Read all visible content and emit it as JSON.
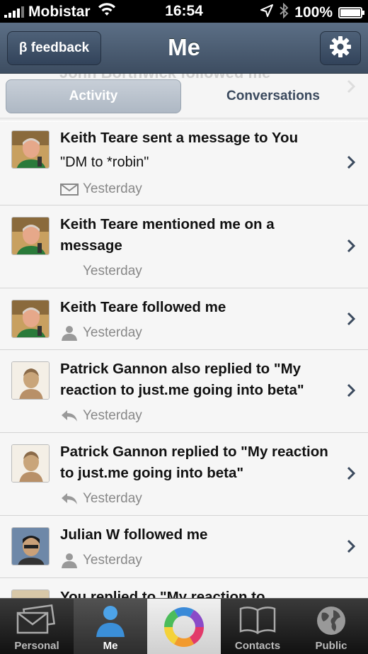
{
  "status_bar": {
    "carrier": "Mobistar",
    "time": "16:54",
    "battery": "100%",
    "battery_level": 1.0
  },
  "nav": {
    "title": "Me",
    "feedback_label": "β feedback"
  },
  "ghost_row": {
    "text": "John Borthwick followed me"
  },
  "segments": {
    "activity": "Activity",
    "conversations": "Conversations",
    "selected": "Activity"
  },
  "items": [
    {
      "title": "Keith Teare sent a message to You",
      "subtitle": "\"DM to *robin\"",
      "time": "Yesterday",
      "icon": "envelope-icon"
    },
    {
      "title": "Keith Teare mentioned me on a message",
      "subtitle": "",
      "time": "Yesterday",
      "icon": "none"
    },
    {
      "title": "Keith Teare followed me",
      "subtitle": "",
      "time": "Yesterday",
      "icon": "person-icon"
    },
    {
      "title": "Patrick Gannon also replied to \"My reaction to just.me going into beta\"",
      "subtitle": "",
      "time": "Yesterday",
      "icon": "reply-icon"
    },
    {
      "title": "Patrick Gannon replied to \"My reaction to just.me going into beta\"",
      "subtitle": "",
      "time": "Yesterday",
      "icon": "reply-icon"
    },
    {
      "title": "Julian W followed me",
      "subtitle": "",
      "time": "Yesterday",
      "icon": "person-icon"
    },
    {
      "title": "You replied to \"My reaction to",
      "subtitle": "",
      "time": "",
      "icon": "none"
    }
  ],
  "tabs": [
    {
      "label": "Personal",
      "icon": "envelopes-icon"
    },
    {
      "label": "Me",
      "icon": "person-icon",
      "active": true
    },
    {
      "label": "",
      "icon": "ring-logo-icon"
    },
    {
      "label": "Contacts",
      "icon": "book-icon"
    },
    {
      "label": "Public",
      "icon": "globe-icon"
    }
  ],
  "colors": {
    "nav_top": "#5c6f86",
    "nav_bottom": "#3d4d61",
    "accent_text": "#3b4a5e",
    "meta_gray": "#888888"
  }
}
